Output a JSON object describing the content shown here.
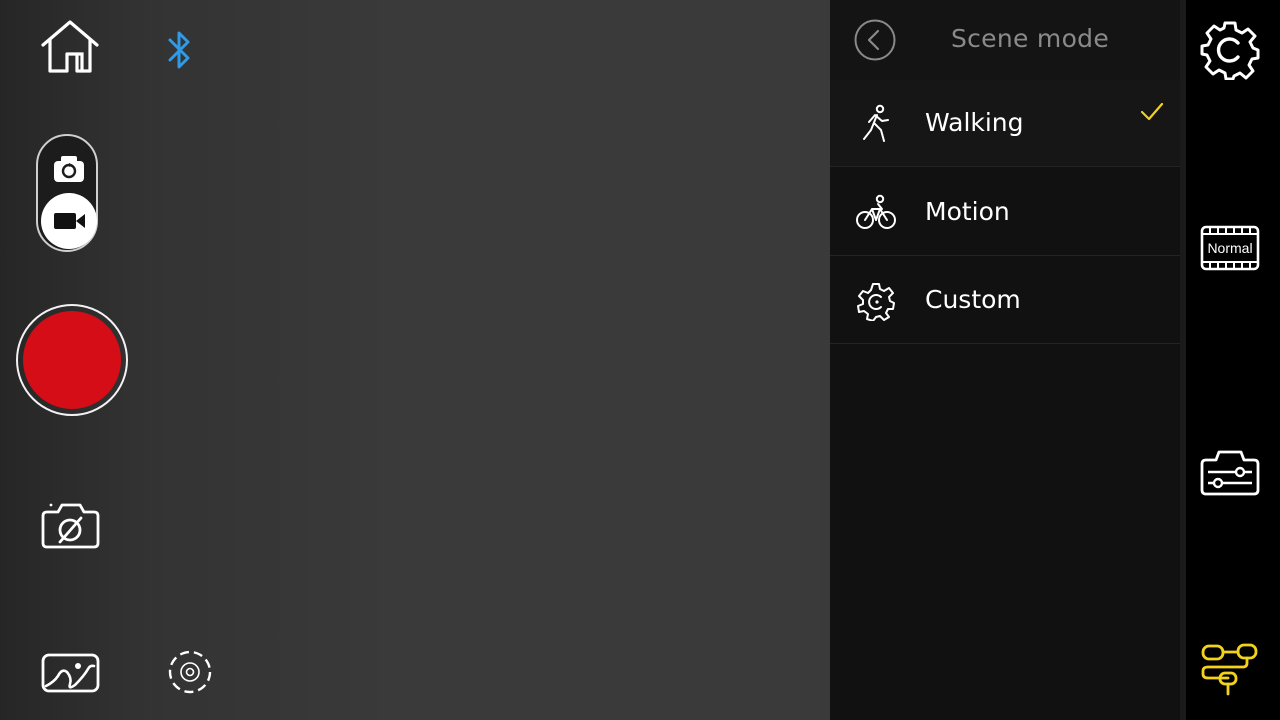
{
  "left_toolbar": {
    "home_icon": "home-icon",
    "bluetooth_icon": "bluetooth-icon",
    "bluetooth_color": "#2f9ae6",
    "mode_toggle": {
      "options": [
        "photo",
        "video"
      ],
      "selected": "video"
    },
    "shutter_color": "#d50d16",
    "camera_off_icon": "camera-off-icon",
    "gallery_icon": "gallery-icon",
    "focus_icon": "focus-target-icon"
  },
  "scene_panel": {
    "title": "Scene mode",
    "items": [
      {
        "label": "Walking",
        "icon": "walking-icon",
        "selected": true
      },
      {
        "label": "Motion",
        "icon": "cycling-icon",
        "selected": false
      },
      {
        "label": "Custom",
        "icon": "custom-gear-icon",
        "selected": false
      }
    ],
    "check_color": "#f2d21b"
  },
  "right_toolbar": {
    "settings_icon": "settings-c-icon",
    "film_mode_label": "Normal",
    "camera_settings_icon": "camera-sliders-icon",
    "gimbal_icon": "gimbal-mode-icon",
    "active_color": "#f2d21b"
  }
}
